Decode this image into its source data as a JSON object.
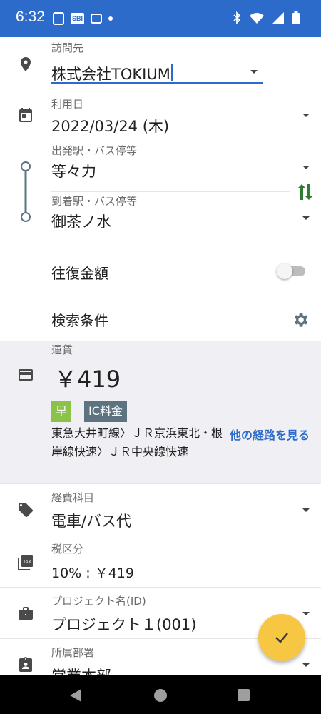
{
  "status_bar": {
    "time": "6:32",
    "bg_color": "#2c6bc9",
    "left_icons": [
      "train-icon",
      "sbi-icon",
      "print-icon",
      "dot-icon"
    ],
    "sbi_label": "SBI",
    "right_icons": [
      "bluetooth-icon",
      "wifi-icon",
      "signal-icon",
      "battery-icon"
    ]
  },
  "form": {
    "destination": {
      "label": "訪問先",
      "value": "株式会社TOKIUM"
    },
    "date": {
      "label": "利用日",
      "value": "2022/03/24 (木)"
    },
    "departure": {
      "label": "出発駅・バス停等",
      "value": "等々力"
    },
    "arrival": {
      "label": "到着駅・バス停等",
      "value": "御茶ノ水"
    },
    "round_trip": {
      "label": "往復金額",
      "enabled": false
    },
    "search_conditions": {
      "label": "検索条件"
    },
    "fare": {
      "label": "運賃",
      "amount": "￥419",
      "badge_early": "早",
      "badge_ic": "IC料金",
      "route": "東急大井町線〉ＪＲ京浜東北・根岸線快速〉ＪＲ中央線快速",
      "other_route_link": "他の経路を見る"
    },
    "expense_category": {
      "label": "経費科目",
      "value": "電車/バス代"
    },
    "tax": {
      "label": "税区分",
      "value": "10% : ￥419",
      "icon_text": "TAX"
    },
    "project": {
      "label": "プロジェクト名(ID)",
      "value": "プロジェクト１(001)"
    },
    "department": {
      "label": "所属部署",
      "value": "営業本部"
    }
  },
  "colors": {
    "accent": "#2c6bc9",
    "fab": "#f7c744",
    "early_badge": "#8bc34a",
    "ic_badge": "#5d7480",
    "swap_icon": "#2e7d32"
  }
}
